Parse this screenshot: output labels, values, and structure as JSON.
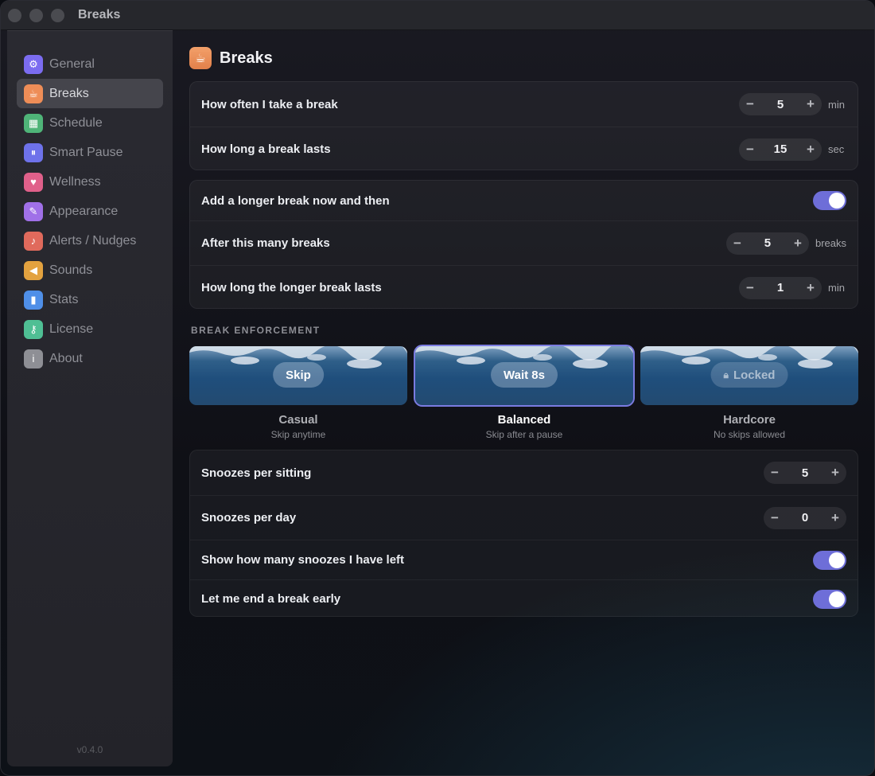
{
  "window": {
    "title": "Breaks"
  },
  "sidebar": {
    "items": [
      {
        "label": "General",
        "icon": "gear-icon",
        "color": "#7b6cf0"
      },
      {
        "label": "Breaks",
        "icon": "cup-icon",
        "color": "#ee8d57"
      },
      {
        "label": "Schedule",
        "icon": "calendar-icon",
        "color": "#4fb478"
      },
      {
        "label": "Smart Pause",
        "icon": "pause-icon",
        "color": "#6e72ea"
      },
      {
        "label": "Wellness",
        "icon": "heart-icon",
        "color": "#e0608a"
      },
      {
        "label": "Appearance",
        "icon": "brush-icon",
        "color": "#a070e8"
      },
      {
        "label": "Alerts / Nudges",
        "icon": "bell-icon",
        "color": "#e06a5c"
      },
      {
        "label": "Sounds",
        "icon": "speaker-icon",
        "color": "#e3a23f"
      },
      {
        "label": "Stats",
        "icon": "bar-chart-icon",
        "color": "#4f8fe8"
      },
      {
        "label": "License",
        "icon": "key-icon",
        "color": "#4fbf94"
      },
      {
        "label": "About",
        "icon": "info-icon",
        "color": "#8e8f95"
      }
    ],
    "active_index": 1,
    "version": "v0.4.0"
  },
  "header": {
    "title": "Breaks"
  },
  "timing": {
    "often_label": "How often I take a break",
    "often_value": "5",
    "often_unit": "min",
    "length_label": "How long a break lasts",
    "length_value": "15",
    "length_unit": "sec"
  },
  "longer": {
    "toggle_label": "Add a longer break now and then",
    "toggle_on": true,
    "after_label": "After this many breaks",
    "after_value": "5",
    "after_unit": "breaks",
    "duration_label": "How long the longer break lasts",
    "duration_value": "1",
    "duration_unit": "min"
  },
  "enforcement": {
    "section_label": "BREAK ENFORCEMENT",
    "modes": [
      {
        "pill": "Skip",
        "name": "Casual",
        "sub": "Skip anytime"
      },
      {
        "pill": "Wait 8s",
        "name": "Balanced",
        "sub": "Skip after a pause"
      },
      {
        "pill": "Locked",
        "name": "Hardcore",
        "sub": "No skips allowed"
      }
    ],
    "selected_index": 1
  },
  "snooze": {
    "sitting_label": "Snoozes per sitting",
    "sitting_value": "5",
    "day_label": "Snoozes per day",
    "day_value": "0",
    "show_left_label": "Show how many snoozes I have left",
    "show_left_on": true,
    "end_early_label": "Let me end a break early",
    "end_early_on": true
  },
  "controls": {
    "minus": "−",
    "plus": "+"
  },
  "colors": {
    "accent": "#6e6ed8",
    "selected_outline": "#7a7be0"
  }
}
